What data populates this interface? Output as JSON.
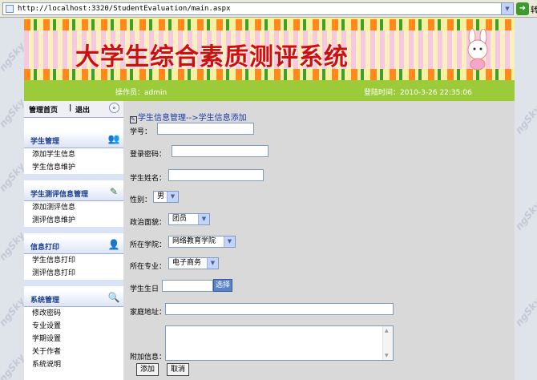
{
  "address_bar": {
    "url": "http://localhost:3320/StudentEvaluation/main.aspx",
    "go_label": "转"
  },
  "banner": {
    "title": "大学生综合素质测评系统"
  },
  "status_bar": {
    "operator": "操作员：admin",
    "login_time": "登陆时间：2010-3-26 22:35:06"
  },
  "watermark": "ngSky",
  "sidebar": {
    "home_link": "管理首页",
    "separator": "|",
    "logout_link": "退出",
    "collapse_symbol": "«",
    "groups": [
      {
        "title": "学生管理",
        "icon": "users-icon",
        "items": [
          "添加学生信息",
          "学生信息维护"
        ]
      },
      {
        "title": "学生测评信息管理",
        "icon": "edit-icon",
        "items": [
          "添加测评信息",
          "测评信息维护"
        ]
      },
      {
        "title": "信息打印",
        "icon": "person-icon",
        "items": [
          "学生信息打印",
          "测评信息打印"
        ]
      },
      {
        "title": "系统管理",
        "icon": "magnifier-icon",
        "items": [
          "修改密码",
          "专业设置",
          "学期设置",
          "关于作者",
          "系统说明"
        ]
      }
    ]
  },
  "form": {
    "breadcrumb": "学生信息管理-->学生信息添加",
    "student_id_label": "学号：",
    "password_label": "登录密码：",
    "name_label": "学生姓名：",
    "gender_label": "性别：",
    "gender_value": "男",
    "politics_label": "政治面貌：",
    "politics_value": "团员",
    "college_label": "所在学院：",
    "college_value": "网络教育学院",
    "major_label": "所在专业：",
    "major_value": "电子商务",
    "birthday_label": "学生生日",
    "choose_button": "选择",
    "address_label": "家庭地址：",
    "extra_label": "附加信息：",
    "add_button": "添加",
    "cancel_button": "取消"
  }
}
